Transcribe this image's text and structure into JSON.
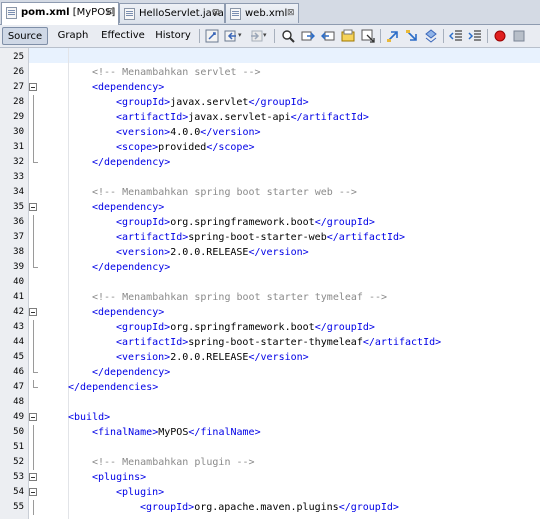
{
  "tabs": [
    {
      "name": "pom.xml",
      "suffix": " [MyPOS]",
      "close": "⊠",
      "active": true
    },
    {
      "name": "HelloServlet.java",
      "suffix": "",
      "close": "⊠",
      "active": false
    },
    {
      "name": "web.xml",
      "suffix": "",
      "close": "⊠",
      "active": false
    }
  ],
  "views": [
    "Source",
    "Graph",
    "Effective",
    "History"
  ],
  "active_view": "Source",
  "toolbar_icons": [
    "last-edit-icon",
    "back-icon",
    "forward-icon",
    "find-icon",
    "find-previous-icon",
    "find-next-icon",
    "toggle-highlight-icon",
    "find-selection-icon",
    "prev-bookmark-icon",
    "next-bookmark-icon",
    "toggle-bookmark-icon",
    "shift-left-icon",
    "shift-right-icon",
    "record-macro-icon",
    "stop-macro-icon"
  ],
  "colors": {
    "tag": "#0000e6",
    "comment": "#8a8a8a",
    "text": "#000000",
    "line_highlight": "#e8f2fe"
  },
  "lines": [
    {
      "n": "25",
      "indent": 0,
      "parts": []
    },
    {
      "n": "26",
      "indent": 2,
      "parts": [
        {
          "t": "<!-- Menambahkan servlet -->",
          "c": "cm"
        }
      ]
    },
    {
      "n": "27",
      "indent": 2,
      "fold": "start",
      "parts": [
        {
          "t": "<dependency>",
          "c": "tg"
        }
      ]
    },
    {
      "n": "28",
      "indent": 3,
      "parts": [
        {
          "t": "<groupId>",
          "c": "tg"
        },
        {
          "t": "javax.servlet",
          "c": "tx"
        },
        {
          "t": "</groupId>",
          "c": "tg"
        }
      ]
    },
    {
      "n": "29",
      "indent": 3,
      "parts": [
        {
          "t": "<artifactId>",
          "c": "tg"
        },
        {
          "t": "javax.servlet-api",
          "c": "tx"
        },
        {
          "t": "</artifactId>",
          "c": "tg"
        }
      ]
    },
    {
      "n": "30",
      "indent": 3,
      "parts": [
        {
          "t": "<version>",
          "c": "tg"
        },
        {
          "t": "4.0.0",
          "c": "tx"
        },
        {
          "t": "</version>",
          "c": "tg"
        }
      ]
    },
    {
      "n": "31",
      "indent": 3,
      "parts": [
        {
          "t": "<scope>",
          "c": "tg"
        },
        {
          "t": "provided",
          "c": "tx"
        },
        {
          "t": "</scope>",
          "c": "tg"
        }
      ]
    },
    {
      "n": "32",
      "indent": 2,
      "fold": "end",
      "parts": [
        {
          "t": "</dependency>",
          "c": "tg"
        }
      ]
    },
    {
      "n": "33",
      "indent": 0,
      "parts": []
    },
    {
      "n": "34",
      "indent": 2,
      "parts": [
        {
          "t": "<!-- Menambahkan spring boot starter web -->",
          "c": "cm"
        }
      ]
    },
    {
      "n": "35",
      "indent": 2,
      "fold": "start",
      "parts": [
        {
          "t": "<dependency>",
          "c": "tg"
        }
      ]
    },
    {
      "n": "36",
      "indent": 3,
      "parts": [
        {
          "t": "<groupId>",
          "c": "tg"
        },
        {
          "t": "org.springframework.boot",
          "c": "tx"
        },
        {
          "t": "</groupId>",
          "c": "tg"
        }
      ]
    },
    {
      "n": "37",
      "indent": 3,
      "parts": [
        {
          "t": "<artifactId>",
          "c": "tg"
        },
        {
          "t": "spring-boot-starter-web",
          "c": "tx"
        },
        {
          "t": "</artifactId>",
          "c": "tg"
        }
      ]
    },
    {
      "n": "38",
      "indent": 3,
      "parts": [
        {
          "t": "<version>",
          "c": "tg"
        },
        {
          "t": "2.0.0.RELEASE",
          "c": "tx"
        },
        {
          "t": "</version>",
          "c": "tg"
        }
      ]
    },
    {
      "n": "39",
      "indent": 2,
      "fold": "end",
      "parts": [
        {
          "t": "</dependency>",
          "c": "tg"
        }
      ]
    },
    {
      "n": "40",
      "indent": 0,
      "parts": []
    },
    {
      "n": "41",
      "indent": 2,
      "parts": [
        {
          "t": "<!-- Menambahkan spring boot starter tymeleaf -->",
          "c": "cm"
        }
      ]
    },
    {
      "n": "42",
      "indent": 2,
      "fold": "start",
      "parts": [
        {
          "t": "<dependency>",
          "c": "tg"
        }
      ]
    },
    {
      "n": "43",
      "indent": 3,
      "parts": [
        {
          "t": "<groupId>",
          "c": "tg"
        },
        {
          "t": "org.springframework.boot",
          "c": "tx"
        },
        {
          "t": "</groupId>",
          "c": "tg"
        }
      ]
    },
    {
      "n": "44",
      "indent": 3,
      "parts": [
        {
          "t": "<artifactId>",
          "c": "tg"
        },
        {
          "t": "spring-boot-starter-thymeleaf",
          "c": "tx"
        },
        {
          "t": "</artifactId>",
          "c": "tg"
        }
      ]
    },
    {
      "n": "45",
      "indent": 3,
      "parts": [
        {
          "t": "<version>",
          "c": "tg"
        },
        {
          "t": "2.0.0.RELEASE",
          "c": "tx"
        },
        {
          "t": "</version>",
          "c": "tg"
        }
      ]
    },
    {
      "n": "46",
      "indent": 2,
      "fold": "end",
      "parts": [
        {
          "t": "</dependency>",
          "c": "tg"
        }
      ]
    },
    {
      "n": "47",
      "indent": 1,
      "fold": "end",
      "parts": [
        {
          "t": "</dependencies>",
          "c": "tg"
        }
      ]
    },
    {
      "n": "48",
      "indent": 0,
      "parts": []
    },
    {
      "n": "49",
      "indent": 1,
      "fold": "start",
      "parts": [
        {
          "t": "<build>",
          "c": "tg"
        }
      ]
    },
    {
      "n": "50",
      "indent": 2,
      "parts": [
        {
          "t": "<finalName>",
          "c": "tg"
        },
        {
          "t": "MyPOS",
          "c": "tx"
        },
        {
          "t": "</finalName>",
          "c": "tg"
        }
      ]
    },
    {
      "n": "51",
      "indent": 0,
      "parts": []
    },
    {
      "n": "52",
      "indent": 2,
      "parts": [
        {
          "t": "<!-- Menambahkan plugin -->",
          "c": "cm"
        }
      ]
    },
    {
      "n": "53",
      "indent": 2,
      "fold": "start",
      "parts": [
        {
          "t": "<plugins>",
          "c": "tg"
        }
      ]
    },
    {
      "n": "54",
      "indent": 3,
      "fold": "start",
      "parts": [
        {
          "t": "<plugin>",
          "c": "tg"
        }
      ]
    },
    {
      "n": "55",
      "indent": 4,
      "parts": [
        {
          "t": "<groupId>",
          "c": "tg"
        },
        {
          "t": "org.apache.maven.plugins",
          "c": "tx"
        },
        {
          "t": "</groupId>",
          "c": "tg"
        }
      ]
    }
  ]
}
